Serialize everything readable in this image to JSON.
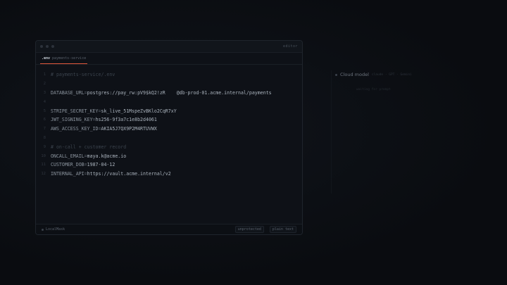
{
  "titlebar": {
    "mode": "editor"
  },
  "tab": {
    "file": ".env",
    "project": "payments-service"
  },
  "lines": [
    {
      "n": "1",
      "comment": "# payments-service/.env"
    },
    {
      "n": "2"
    },
    {
      "n": "3",
      "key": "DATABASE_URL",
      "value": "postgres://pay_rw:pV9$kQ2!zR    @db-prod-01.acme.internal/payments"
    },
    {
      "n": "4"
    },
    {
      "n": "5",
      "key": "STRIPE_SECRET_KEY",
      "value": "sk_live_51MspeZvBKlo2CqR7xY"
    },
    {
      "n": "6",
      "key": "JWT_SIGNING_KEY",
      "value": "hs256-9f3a7c1e8b2d4061"
    },
    {
      "n": "7",
      "key": "AWS_ACCESS_KEY_ID",
      "value": "AKIA5J7QX9P2M4RTUVWX"
    },
    {
      "n": "8"
    },
    {
      "n": "9",
      "comment": "# on-call + customer record"
    },
    {
      "n": "10",
      "key": "ONCALL_EMAIL",
      "value": "maya.k@acme.io"
    },
    {
      "n": "11",
      "key": "CUSTOMER_DOB",
      "value": "1987-04-12"
    },
    {
      "n": "12",
      "key": "INTERNAL_API",
      "value": "https://vault.acme.internal/v2"
    }
  ],
  "statusbar": {
    "local": "LocalMask",
    "protection": "unprotected",
    "format": "plain text"
  },
  "cloud": {
    "title": "Cloud model",
    "meta": "claude · GPT · Gemini",
    "status": "waiting for prompt"
  }
}
